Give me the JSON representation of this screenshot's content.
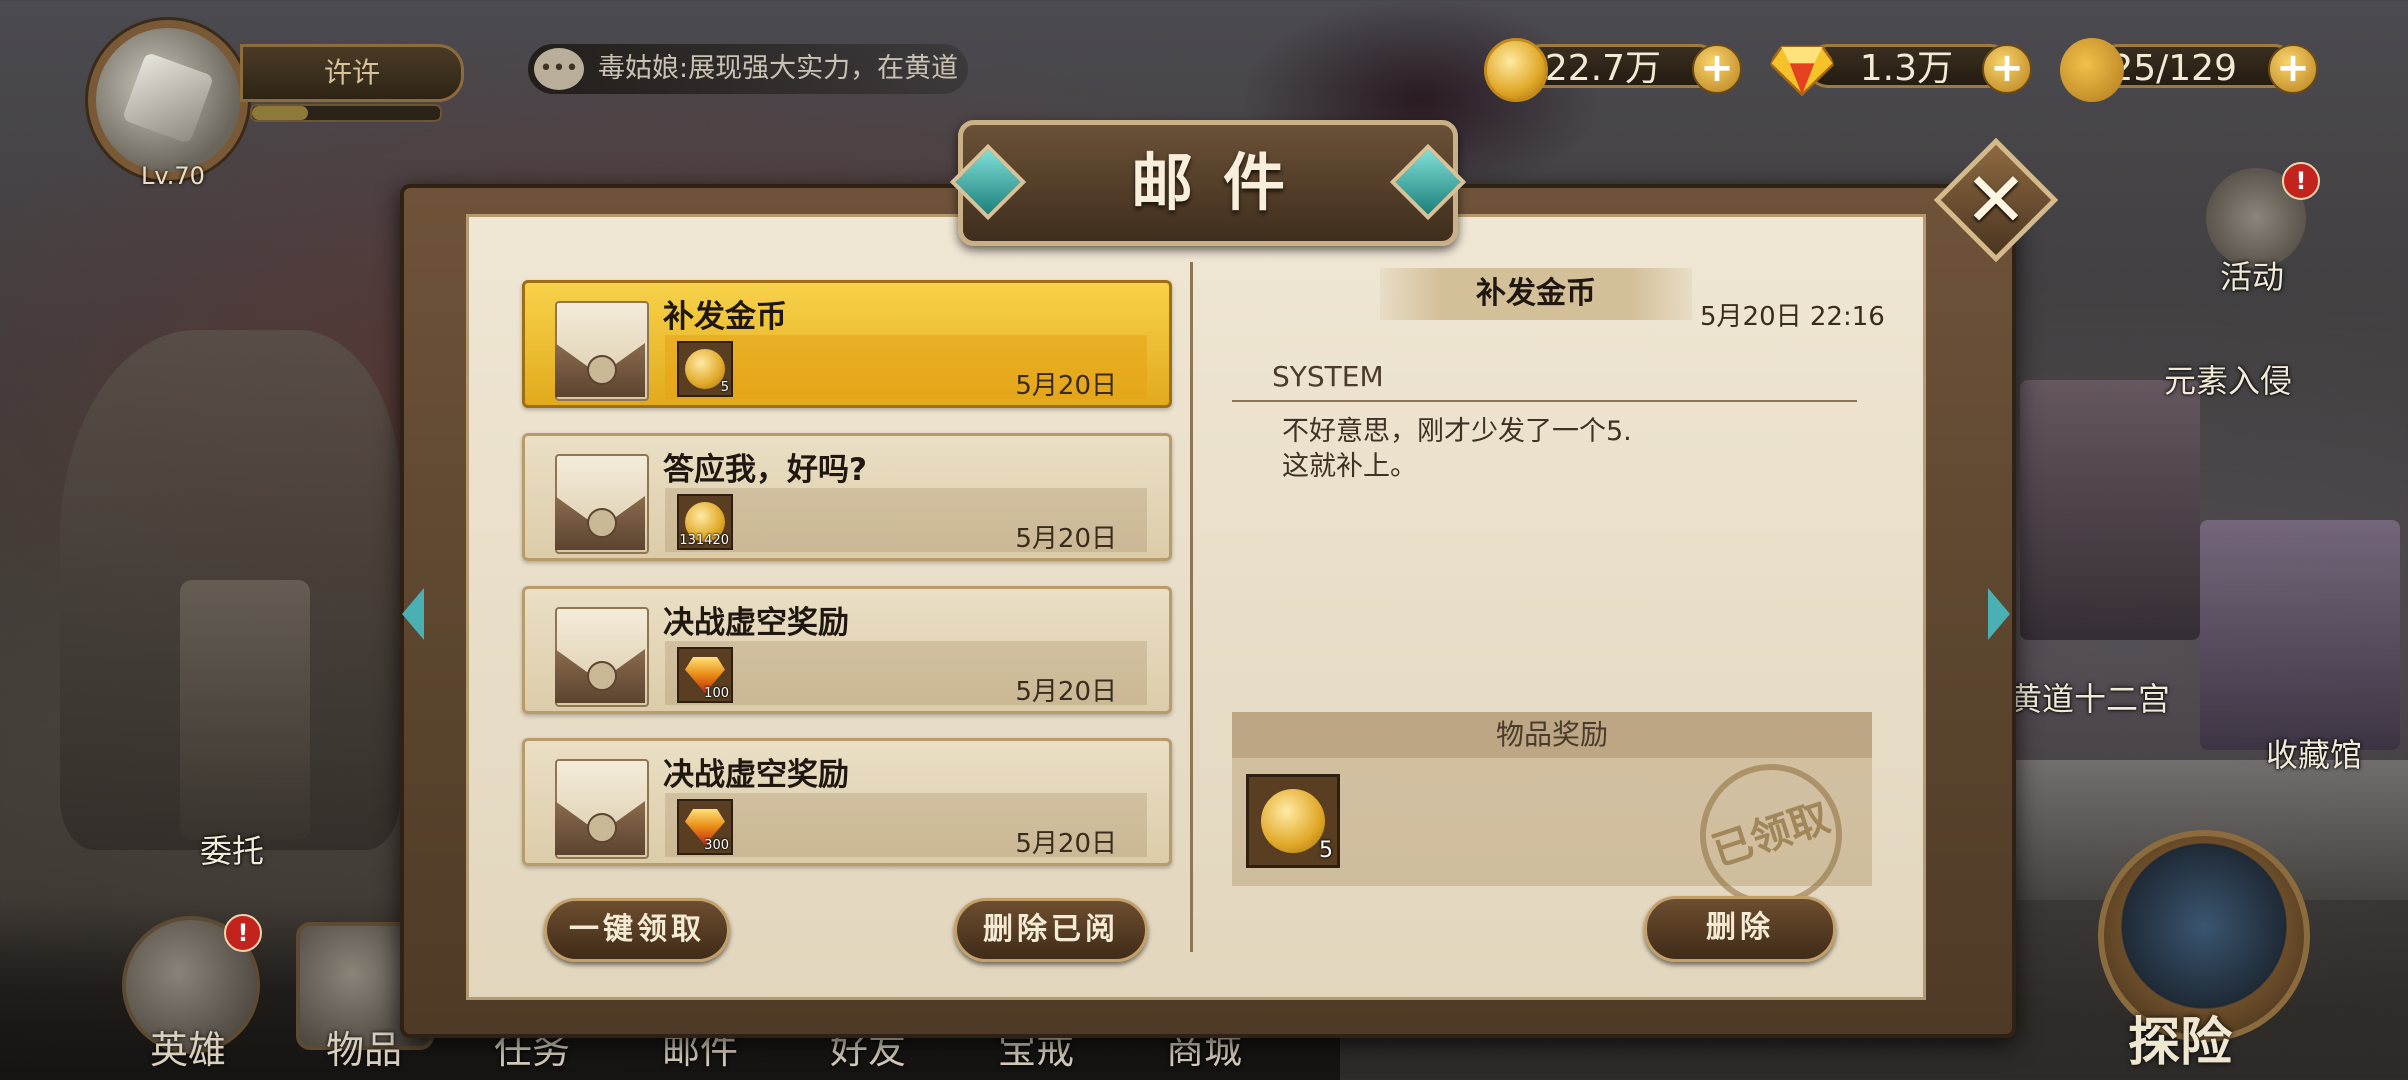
{
  "player": {
    "name": "许许",
    "level": "Lv.70",
    "exp_fraction": 0.3
  },
  "chat": {
    "message": "毒姑娘:展现强大实力，在黄道"
  },
  "resources": [
    {
      "icon": "gold-coin-icon",
      "value": "22.7万"
    },
    {
      "icon": "diamond-icon",
      "value": "1.3万"
    },
    {
      "icon": "stamina-bread-icon",
      "value": "25/129"
    }
  ],
  "side_features": {
    "activity": "活动",
    "element_invasion": "元素入侵",
    "zodiac": "黄道十二宫",
    "museum": "收藏馆",
    "commission": "委托",
    "explore": "探险"
  },
  "bottom_nav": [
    "英雄",
    "物品",
    "任务",
    "邮件",
    "好友",
    "宝戒",
    "商城"
  ],
  "dialog": {
    "title": "邮件",
    "close_icon": "close-x-icon",
    "mails": [
      {
        "title": "补发金币",
        "reward_type": "coin",
        "reward_qty": "5",
        "date": "5月20日",
        "selected": true
      },
      {
        "title": "答应我，好吗?",
        "reward_type": "coin",
        "reward_qty": "131420",
        "date": "5月20日",
        "selected": false
      },
      {
        "title": "决战虚空奖励",
        "reward_type": "gem",
        "reward_qty": "100",
        "date": "5月20日",
        "selected": false
      },
      {
        "title": "决战虚空奖励",
        "reward_type": "gem",
        "reward_qty": "300",
        "date": "5月20日",
        "selected": false
      }
    ],
    "claim_all_label": "一键领取",
    "delete_read_label": "删除已阅",
    "detail": {
      "title": "补发金币",
      "datetime": "5月20日 22:16",
      "sender": "SYSTEM",
      "body": "不好意思，刚才少发了一个5.\n这就补上。",
      "reward_header": "物品奖励",
      "reward_qty": "5",
      "stamp_text": "已领取",
      "delete_label": "删除"
    }
  }
}
